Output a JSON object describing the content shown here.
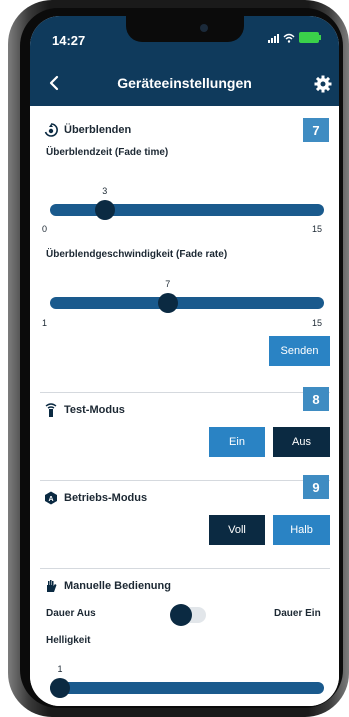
{
  "status": {
    "time": "14:27"
  },
  "nav": {
    "title": "Geräteeinstellungen"
  },
  "fade": {
    "title": "Überblenden",
    "badge": "7",
    "time_label": "Überblendzeit (Fade time)",
    "time_value": "3",
    "time_min": "0",
    "time_max": "15",
    "time_fraction": 0.2,
    "rate_label": "Überblendgeschwindigkeit (Fade rate)",
    "rate_value": "7",
    "rate_min": "1",
    "rate_max": "15",
    "rate_fraction": 0.43,
    "send_label": "Senden"
  },
  "test_mode": {
    "title": "Test-Modus",
    "badge": "8",
    "on_label": "Ein",
    "off_label": "Aus",
    "selected": "Aus"
  },
  "operation_mode": {
    "title": "Betriebs-Modus",
    "badge": "9",
    "full_label": "Voll",
    "half_label": "Halb",
    "selected": "Voll"
  },
  "manual": {
    "title": "Manuelle Bedienung",
    "left_label": "Dauer Aus",
    "right_label": "Dauer Ein",
    "toggle_on": false,
    "brightness_label": "Helligkeit",
    "brightness_value": "1",
    "brightness_fraction": 0.0
  },
  "colors": {
    "header": "#0f3a5c",
    "accent": "#2a83c4",
    "dark": "#0b2a42",
    "badge": "#3f8cc2"
  },
  "icons": [
    "back-icon",
    "gear-icon",
    "fade-icon",
    "test-icon",
    "mode-icon",
    "hand-icon"
  ]
}
